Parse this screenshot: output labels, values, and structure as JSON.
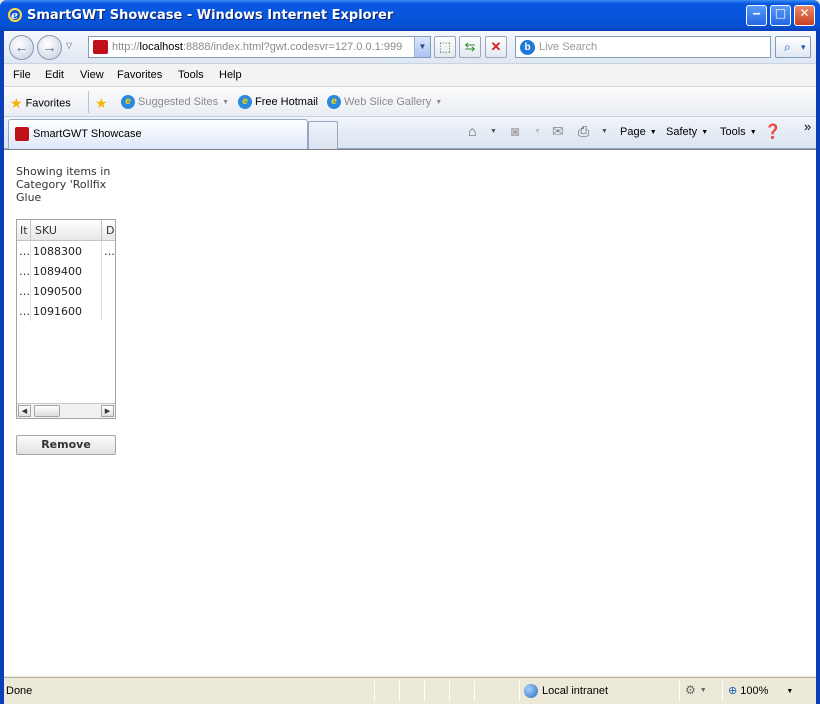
{
  "window": {
    "title": "SmartGWT Showcase - Windows Internet Explorer",
    "min": "‒",
    "max": "□",
    "close": "✕"
  },
  "navbar": {
    "back": "←",
    "forward": "→",
    "history_drop": "▽",
    "address_prefix": "http://",
    "address_host": "localhost",
    "address_rest": ":8888/index.html?gwt.codesvr=127.0.0.1:999",
    "address_drop": "▼",
    "compat": "⬚",
    "refresh": "⇆",
    "stop": "✕",
    "search_placeholder": "Live Search",
    "search_go": "⌕",
    "search_drop": "▾"
  },
  "menubar": {
    "items": [
      "File",
      "Edit",
      "View",
      "Favorites",
      "Tools",
      "Help"
    ]
  },
  "favorites_bar": {
    "favorites": "Favorites",
    "suggested": "Suggested Sites",
    "hotmail": "Free Hotmail",
    "webslice": "Web Slice Gallery"
  },
  "tabs": {
    "active_label": "SmartGWT Showcase"
  },
  "command_bar": {
    "page": "Page",
    "safety": "Safety",
    "tools": "Tools",
    "more": "»"
  },
  "content": {
    "caption": "Showing items in Category 'Rollfix Glue",
    "grid": {
      "columns": [
        "It",
        "SKU",
        "D"
      ],
      "rows": [
        [
          "…",
          "1088300",
          "…"
        ],
        [
          "…",
          "1089400",
          ""
        ],
        [
          "…",
          "1090500",
          ""
        ],
        [
          "…",
          "1091600",
          ""
        ]
      ],
      "scroll_left": "◀",
      "scroll_right": "▶"
    },
    "remove_label": "Remove"
  },
  "statusbar": {
    "text": "Done",
    "zone": "Local intranet",
    "zoom": "100%",
    "zoom_icon": "⊕"
  }
}
